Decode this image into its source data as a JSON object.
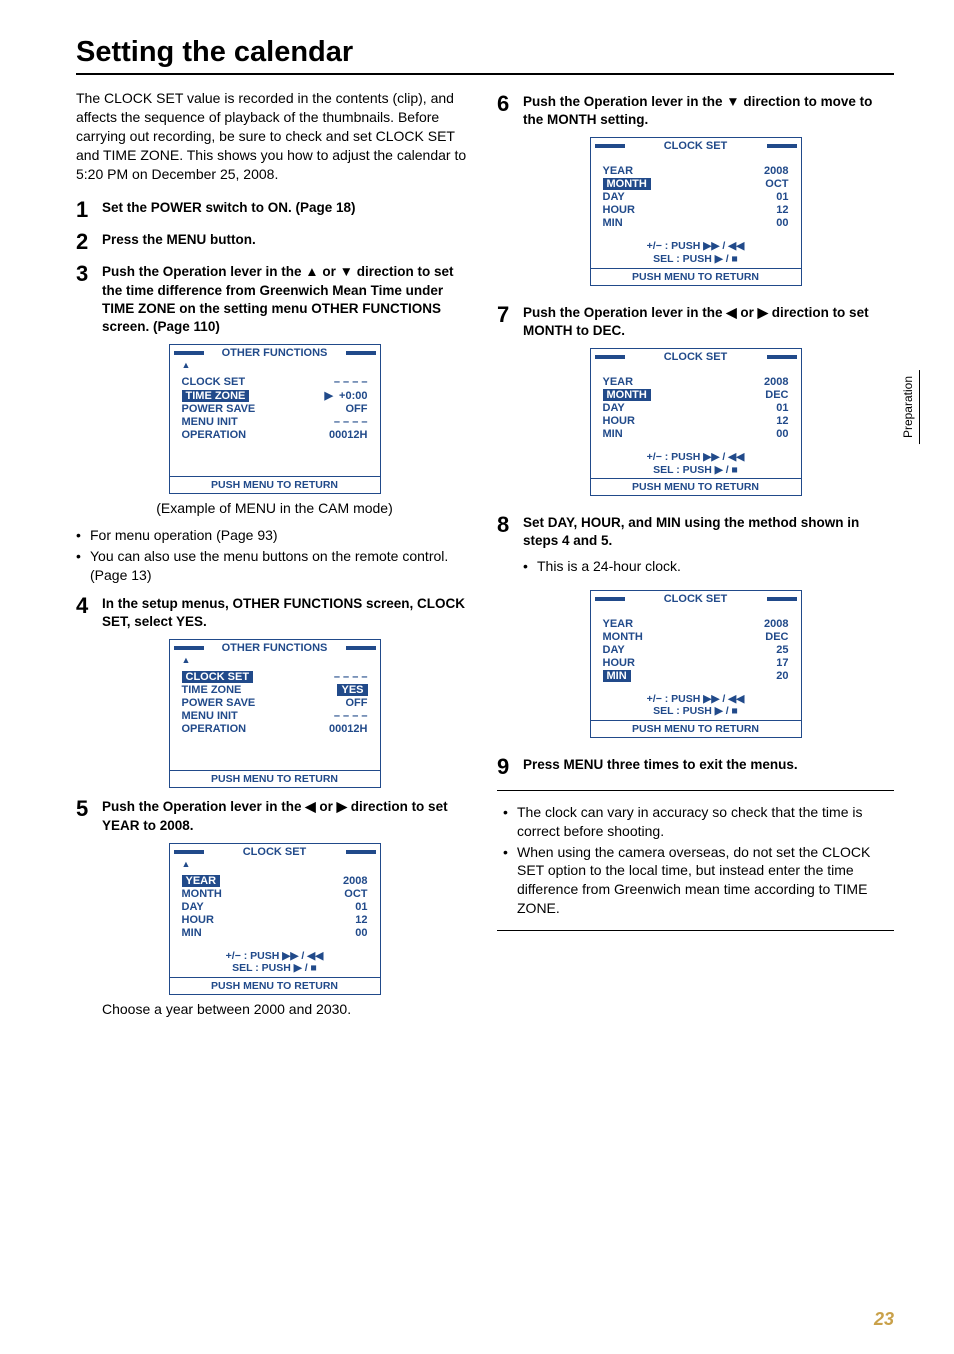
{
  "title": "Setting the calendar",
  "side_tab": "Preparation",
  "page_number": "23",
  "intro": "The CLOCK SET value is recorded in the contents (clip), and affects the sequence of playback of the thumbnails. Before carrying out recording, be sure to check and set CLOCK SET and TIME ZONE. This shows you how to adjust the calendar to 5:20 PM on December 25, 2008.",
  "steps": {
    "s1": {
      "num": "1",
      "instr": "Set the POWER switch to ON. (Page 18)"
    },
    "s2": {
      "num": "2",
      "instr": "Press the MENU button."
    },
    "s3": {
      "num": "3",
      "instr": "Push the Operation lever in the ▲ or ▼ direction to set the time difference from Greenwich Mean Time under TIME ZONE on the setting menu OTHER FUNCTIONS screen. (Page 110)"
    },
    "s4": {
      "num": "4",
      "instr": "In the setup menus, OTHER FUNCTIONS screen, CLOCK SET, select YES."
    },
    "s5": {
      "num": "5",
      "instr": "Push the Operation lever in the ◀ or ▶ direction to set YEAR to 2008."
    },
    "s6": {
      "num": "6",
      "instr": "Push the Operation lever in the ▼ direction to move to the MONTH setting."
    },
    "s7": {
      "num": "7",
      "instr": "Push the Operation lever in the ◀ or ▶ direction to set MONTH to DEC."
    },
    "s8": {
      "num": "8",
      "instr": "Set DAY, HOUR, and MIN using the method shown in steps 4 and 5.",
      "sub": "This is a 24-hour clock."
    },
    "s9": {
      "num": "9",
      "instr": "Press MENU three times to exit the menus."
    }
  },
  "caption3": "(Example of MENU in the CAM mode)",
  "bullets3": {
    "b1": "For menu operation (Page 93)",
    "b2": "You can also use the menu buttons on the remote control. (Page 13)"
  },
  "footnote5": "Choose a year between 2000 and 2030.",
  "notes": {
    "n1": "The clock can vary in accuracy so check that the time is correct before shooting.",
    "n2": "When using the camera overseas, do not set the CLOCK SET option to the local time, but instead enter the time difference from Greenwich mean time according to TIME ZONE."
  },
  "menu": {
    "other_title": "OTHER FUNCTIONS",
    "clock_title": "CLOCK SET",
    "footer": "PUSH  MENU TO RETURN",
    "hints_pm": "+/− : PUSH ▶▶ / ◀◀",
    "hints_sel": "SEL : PUSH ▶ / ■",
    "items": {
      "clock_set": "CLOCK SET",
      "time_zone": "TIME ZONE",
      "power_save": "POWER SAVE",
      "menu_init": "MENU INIT",
      "operation": "OPERATION",
      "year": "YEAR",
      "month": "MONTH",
      "day": "DAY",
      "hour": "HOUR",
      "min": "MIN"
    },
    "vals": {
      "dashes": "– – – –",
      "tz": "+0:00",
      "off": "OFF",
      "op": "00012H",
      "yes": "YES",
      "y2008": "2008",
      "oct": "OCT",
      "dec": "DEC",
      "d01": "01",
      "d25": "25",
      "h12": "12",
      "h17": "17",
      "m00": "00",
      "m20": "20"
    }
  }
}
